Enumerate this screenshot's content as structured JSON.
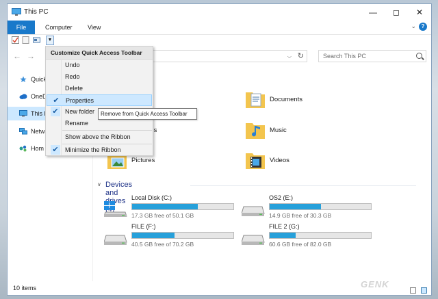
{
  "window": {
    "title": "This PC"
  },
  "menubar": {
    "file": "File",
    "computer": "Computer",
    "view": "View",
    "help": "?",
    "expand": "⌄"
  },
  "qat_menu": {
    "header": "Customize Quick Access Toolbar",
    "items": [
      {
        "label": "Undo",
        "checked": false
      },
      {
        "label": "Redo",
        "checked": false
      },
      {
        "label": "Delete",
        "checked": false
      },
      {
        "label": "Properties",
        "checked": true
      },
      {
        "label": "New folder",
        "checked": true
      },
      {
        "label": "Rename",
        "checked": false
      },
      {
        "label": "Show above the Ribbon",
        "checked": false
      },
      {
        "label": "Minimize the Ribbon",
        "checked": true
      }
    ]
  },
  "tooltip": "Remove from Quick Access Toolbar",
  "search": {
    "placeholder": "Search This PC"
  },
  "sidebar": {
    "items": [
      {
        "label": "Quick"
      },
      {
        "label": "OneD"
      },
      {
        "label": "This P"
      },
      {
        "label": "Netw"
      },
      {
        "label": "Hom"
      }
    ]
  },
  "folders": [
    {
      "name": "Documents"
    },
    {
      "name": "ads"
    },
    {
      "name": "Music"
    },
    {
      "name": "Pictures"
    },
    {
      "name": "Videos"
    }
  ],
  "devices": {
    "heading": "Devices and drives (4)",
    "drives": [
      {
        "name": "Local Disk (C:)",
        "free": "17.3 GB free of 50.1 GB",
        "used_fraction": 0.65
      },
      {
        "name": "OS2 (E:)",
        "free": "14.9 GB free of 30.3 GB",
        "used_fraction": 0.51
      },
      {
        "name": "FILE (F:)",
        "free": "40.5 GB free of 70.2 GB",
        "used_fraction": 0.42
      },
      {
        "name": "FILE 2 (G:)",
        "free": "60.6 GB free of 82.0 GB",
        "used_fraction": 0.26
      }
    ]
  },
  "status": {
    "items": "10 items"
  },
  "watermark": "GENK",
  "colors": {
    "accent": "#1979ca",
    "drive_fill": "#26a0da",
    "folder": "#f3c54e"
  }
}
